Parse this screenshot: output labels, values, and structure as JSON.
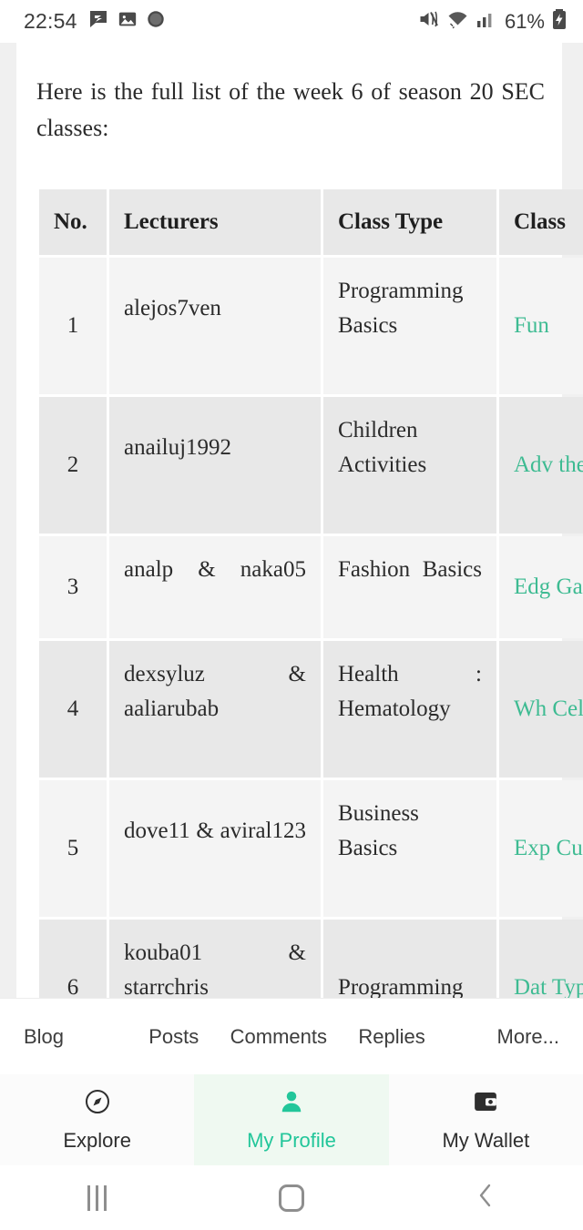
{
  "status_bar": {
    "time": "22:54",
    "left_icons": [
      "chat-bubble-icon",
      "gallery-icon",
      "circle-app-icon"
    ],
    "right_icons": [
      "mute-icon",
      "wifi-icon",
      "cellular-signal-icon",
      "battery-charging-icon"
    ],
    "battery_percent": "61%"
  },
  "article": {
    "intro": "Here is the full list of the week 6 of season 20 SEC classes:"
  },
  "table": {
    "columns": [
      "No.",
      "Lecturers",
      "Class Type",
      "Class"
    ],
    "rows": [
      {
        "no": "1",
        "lecturers": "alejos7ven",
        "class_type": "Programming Basics",
        "class": "Fun"
      },
      {
        "no": "2",
        "lecturers": "anailuj1992",
        "class_type": "Children Activities",
        "class": "Adv the"
      },
      {
        "no": "3",
        "lecturers": "analp & naka05",
        "class_type": "Fashion Basics",
        "class": "Edg Gar Ros"
      },
      {
        "no": "4",
        "lecturers": "dexsyluz & aaliarubab",
        "class_type": "Health : Hematology",
        "class": "Wh Cell"
      },
      {
        "no": "5",
        "lecturers": "dove11 & aviral123",
        "class_type": "Business Basics",
        "class": "Exp Cus Sup"
      },
      {
        "no": "6",
        "lecturers": "kouba01 & starrchris",
        "class_type": "Programming",
        "class": "Dat Typ Stri Pre Met"
      }
    ]
  },
  "tab_strip": {
    "tabs": [
      {
        "label": "Blog"
      },
      {
        "label": "Posts"
      },
      {
        "label": "Comments"
      },
      {
        "label": "Replies"
      },
      {
        "label": "More..."
      }
    ]
  },
  "bottom_nav": {
    "items": [
      {
        "label": "Explore",
        "icon": "compass-icon",
        "active": false
      },
      {
        "label": "My Profile",
        "icon": "person-icon",
        "active": true
      },
      {
        "label": "My Wallet",
        "icon": "wallet-icon",
        "active": false
      }
    ]
  },
  "system_nav": {
    "recents": "recent-apps-icon",
    "home": "home-icon",
    "back": "back-icon"
  },
  "colors": {
    "accent_green": "#3ebb92",
    "nav_active_green": "#22c69a",
    "nav_active_bg": "#eff9f1",
    "row_odd": "#f4f4f4",
    "row_even": "#e8e8e8",
    "header_bg": "#e8e8e8"
  }
}
